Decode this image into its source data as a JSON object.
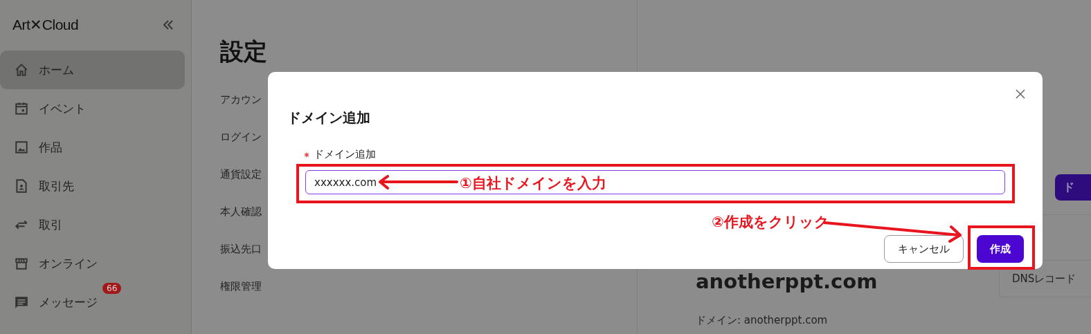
{
  "sidebar": {
    "logo": "Art✕Cloud",
    "items": [
      {
        "label": "ホーム",
        "selected": true
      },
      {
        "label": "イベント",
        "selected": false
      },
      {
        "label": "作品",
        "selected": false
      },
      {
        "label": "取引先",
        "selected": false
      },
      {
        "label": "取引",
        "selected": false
      },
      {
        "label": "オンライン",
        "selected": false
      },
      {
        "label": "メッセージ",
        "selected": false,
        "badge": "66"
      }
    ]
  },
  "page": {
    "title": "設定",
    "settings_items": [
      "アカウン",
      "ログイン",
      "通貨設定",
      "本人確認",
      "振込先口",
      "権限管理"
    ]
  },
  "detail": {
    "add_button": "ド",
    "domain_heading": "anotherppt.com",
    "dns_button": "DNSレコード",
    "domain_line": "ドメイン: anotherppt.com"
  },
  "dialog": {
    "title": "ドメイン追加",
    "field": {
      "label": "ドメイン追加",
      "required": true,
      "value": "xxxxxx.com"
    },
    "buttons": [
      {
        "label": "キャンセル",
        "kind": "secondary"
      },
      {
        "label": "作成",
        "kind": "primary"
      }
    ]
  },
  "annotations": [
    {
      "text": "①自社ドメインを入力"
    },
    {
      "text": "②作成をクリック"
    }
  ]
}
